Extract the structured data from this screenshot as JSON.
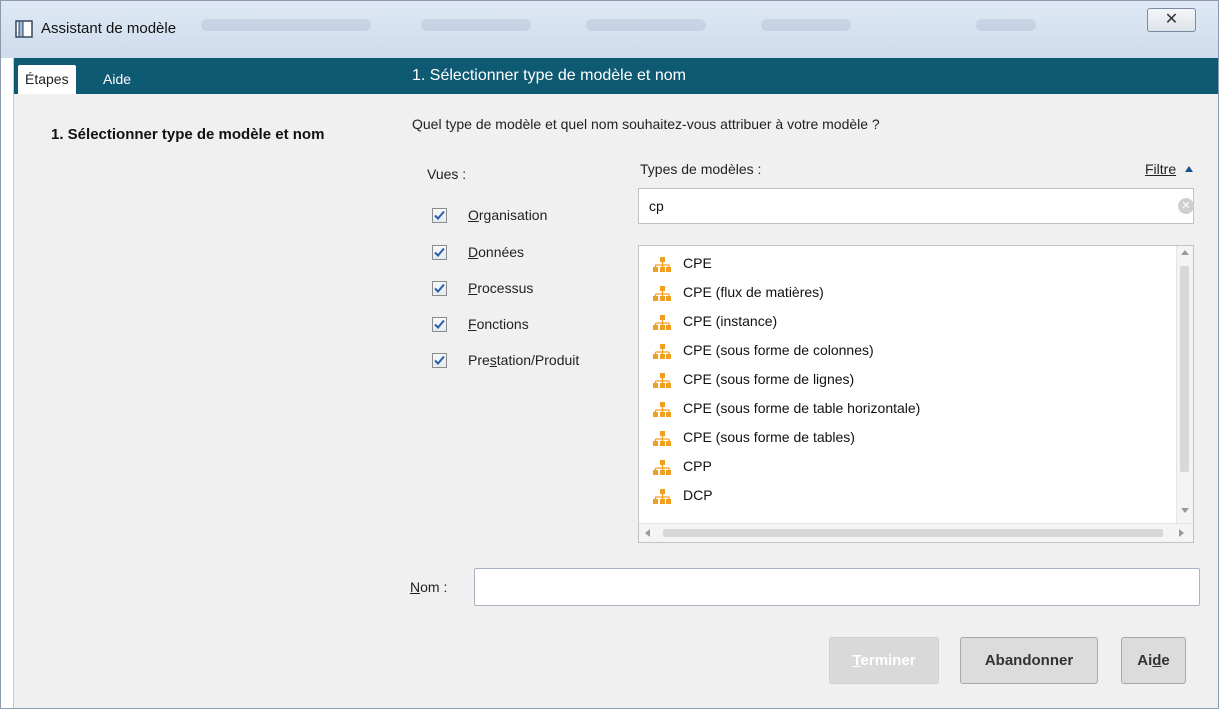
{
  "window": {
    "title": "Assistant de modèle",
    "close_label": "X"
  },
  "left": {
    "tabs": [
      {
        "label": "Étapes",
        "active": true
      },
      {
        "label": "Aide",
        "active": false
      }
    ],
    "step": "1. Sélectionner type de modèle et nom"
  },
  "right": {
    "header": "1. Sélectionner type de modèle et nom",
    "question": "Quel type de modèle et quel nom souhaitez-vous attribuer à votre modèle ?",
    "vues_label": "Vues :",
    "vues": [
      {
        "pre": "",
        "mn": "O",
        "post": "rganisation",
        "checked": true
      },
      {
        "pre": "",
        "mn": "D",
        "post": "onnées",
        "checked": true
      },
      {
        "pre": "",
        "mn": "P",
        "post": "rocessus",
        "checked": true
      },
      {
        "pre": "",
        "mn": "F",
        "post": "onctions",
        "checked": true
      },
      {
        "pre": "Pre",
        "mn": "s",
        "post": "tation/Produit",
        "checked": true
      }
    ],
    "types_label": "Types de modèles :",
    "filter_label": "Filtre",
    "search_value": "cp",
    "model_types": [
      "CPE",
      "CPE (flux de matières)",
      "CPE (instance)",
      "CPE (sous forme de colonnes)",
      "CPE (sous forme de lignes)",
      "CPE (sous forme de table horizontale)",
      "CPE (sous forme de tables)",
      "CPP",
      "DCP"
    ],
    "nom": {
      "mn": "N",
      "post": "om :",
      "value": ""
    },
    "buttons": {
      "terminer": {
        "mn": "T",
        "post": "erminer",
        "enabled": false
      },
      "abandonner": {
        "label": "Abandonner"
      },
      "aide": {
        "pre": "Ai",
        "mn": "d",
        "post": "e"
      }
    }
  },
  "colors": {
    "header_bg": "#0f5a73",
    "icon_orange": "#f0a020"
  }
}
